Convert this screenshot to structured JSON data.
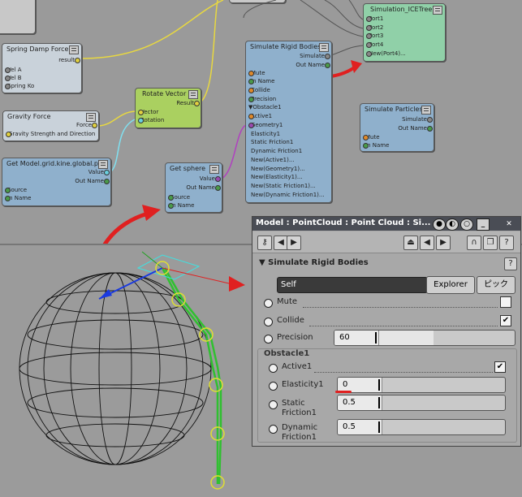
{
  "graph": {
    "nodes": {
      "spring": {
        "title": "Spring Damp Force",
        "ports": [
          "Vel A",
          "Vel B",
          "Spring Ko"
        ],
        "outputs": [
          "result"
        ]
      },
      "gravity": {
        "title": "Gravity Force",
        "outputs": [
          "Force"
        ],
        "ports": [
          "Gravity Strength and Direction"
        ]
      },
      "getmodel": {
        "title": "Get Model.grid.kine.global.pos",
        "outputs": [
          "Value",
          "Out Name"
        ],
        "ports": [
          "Source",
          "In Name"
        ]
      },
      "rotate": {
        "title": "Rotate Vector",
        "outputs": [
          "Result"
        ],
        "ports": [
          "Vector",
          "Rotation"
        ]
      },
      "getsphere": {
        "title": "Get sphere",
        "outputs": [
          "Value",
          "Out Name"
        ],
        "ports": [
          "Source",
          "In Name"
        ]
      },
      "srb": {
        "title": "Simulate Rigid Bodies",
        "outputs": [
          "Simulate",
          "Out Name"
        ],
        "ports": [
          "Mute",
          "In Name",
          "Collide",
          "Precision",
          "▼Obstacle1",
          "Active1",
          "Geometry1",
          "Elasticity1",
          "Static Friction1",
          "Dynamic Friction1",
          "New(Active1)...",
          "New(Geometry1)...",
          "New(Elasticity1)...",
          "New(Static Friction1)...",
          "New(Dynamic Friction1)..."
        ]
      },
      "icetree": {
        "title": "Simulation_ICETree",
        "ports": [
          "Port1",
          "Port2",
          "Port3",
          "Port4",
          "New(Port4)..."
        ]
      },
      "sp": {
        "title": "Simulate Particles",
        "outputs": [
          "Simulate",
          "Out Name"
        ],
        "ports": [
          "Mute",
          "In Name"
        ]
      }
    }
  },
  "panel": {
    "title": "Model : PointCloud : Point Cloud : Si...",
    "section": "Simulate Rigid Bodies",
    "self_value": "Self",
    "explorer_label": "Explorer",
    "pick_label": "ピック",
    "help_label": "?",
    "mute_label": "Mute",
    "collide_label": "Collide",
    "precision_label": "Precision",
    "precision_value": "60",
    "obstacle_label": "Obstacle1",
    "active_label": "Active1",
    "elasticity_label": "Elasticity1",
    "elasticity_value": "0",
    "static_label_1": "Static",
    "static_label_2": "Friction1",
    "static_value": "0.5",
    "dynamic_label_1": "Dynamic",
    "dynamic_label_2": "Friction1",
    "dynamic_value": "0.5",
    "collide_checked": true,
    "active_checked": true,
    "mute_checked": false,
    "precision_fraction": 0.55,
    "elasticity_fraction": 0.0,
    "static_fraction": 0.1,
    "dynamic_fraction": 0.1
  },
  "colors": {
    "annotation_arrow": "#e02020",
    "wire_yellow": "#e8d840",
    "wire_cyan": "#80e0f0",
    "wire_purple": "#b040c0",
    "wire_gray": "#555555"
  }
}
